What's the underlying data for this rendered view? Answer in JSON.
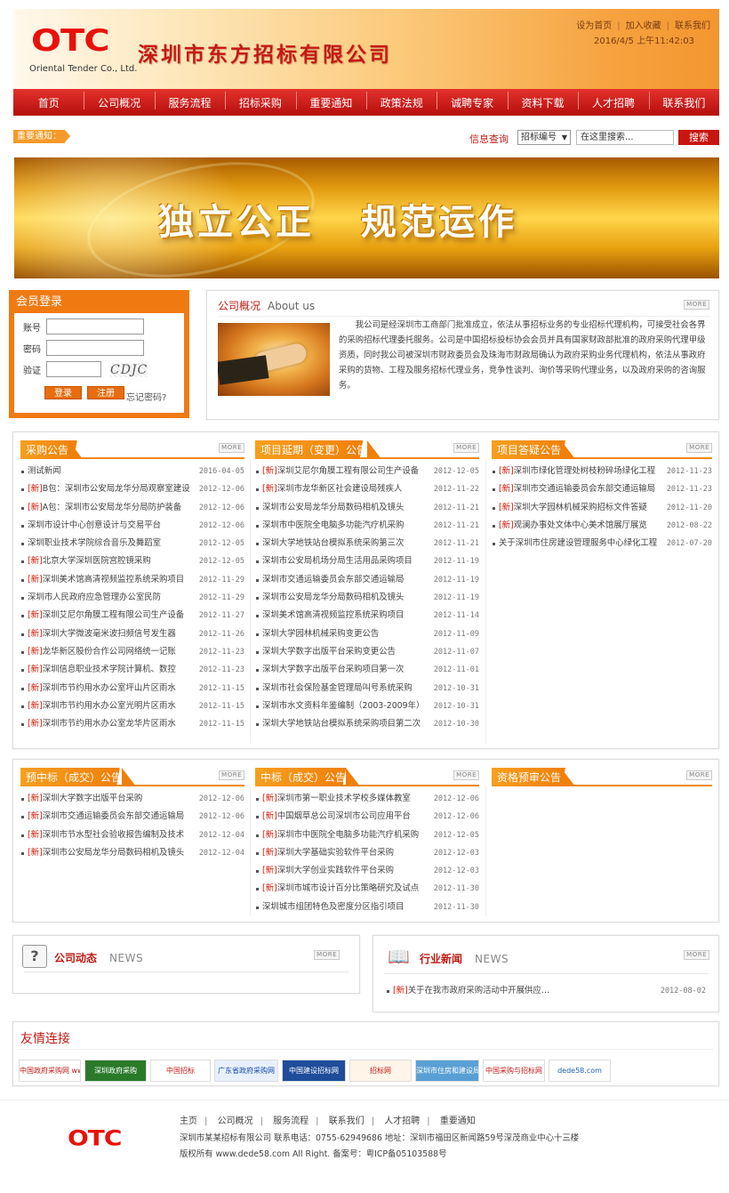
{
  "header": {
    "logo": "OTC",
    "logo_sub": "Oriental Tender Co., Ltd.",
    "company": "深圳市东方招标有限公司",
    "top_links": [
      "设为首页",
      "加入收藏",
      "联系我们"
    ],
    "datetime": "2016/4/5 上午11:42:03"
  },
  "nav": [
    "首页",
    "公司概况",
    "服务流程",
    "招标采购",
    "重要通知",
    "政策法规",
    "诚聘专家",
    "资料下载",
    "人才招聘",
    "联系我们"
  ],
  "notice_label": "重要通知：",
  "search": {
    "label": "信息查询",
    "select": "招标编号",
    "placeholder": "在这里搜索...",
    "button": "搜索"
  },
  "banner": {
    "left": "独立公正",
    "right": "规范运作"
  },
  "login": {
    "title": "会员登录",
    "account": "账号",
    "password": "密码",
    "verify": "验证",
    "captcha": "CDJC",
    "login_btn": "登录",
    "register_btn": "注册",
    "forgot": "忘记密码?"
  },
  "about": {
    "title": "公司概况",
    "title_en": "About us",
    "more": "MORE",
    "text": "我公司是经深圳市工商部门批准成立，依法从事招标业务的专业招标代理机构，可接受社会各界的采购招标代理委托服务。公司是中国招标投标协会会员并具有国家财政部批准的政府采购代理甲级资质，同时我公司被深圳市财政委员会及珠海市财政局确认为政府采购业务代理机构，依法从事政府采购的货物、工程及服务招标代理业务，竞争性谈判、询价等采购代理业务，以及政府采购的咨询服务。"
  },
  "more": "MORE",
  "new_tag": "[新]",
  "procurement": {
    "title": "采购公告",
    "items": [
      {
        "new": false,
        "t": "测试新闻",
        "d": "2016-04-05"
      },
      {
        "new": true,
        "t": "B包：深圳市公安局龙华分局观察室建设",
        "d": "2012-12-06"
      },
      {
        "new": true,
        "t": "A包：深圳市公安局龙华分局防护装备",
        "d": "2012-12-06"
      },
      {
        "new": false,
        "t": "深圳市设计中心创意设计与交易平台",
        "d": "2012-12-06"
      },
      {
        "new": false,
        "t": "深圳职业技术学院综合音乐及舞蹈室",
        "d": "2012-12-05"
      },
      {
        "new": true,
        "t": "北京大学深圳医院宫腔镜采购",
        "d": "2012-12-05"
      },
      {
        "new": true,
        "t": "深圳美术馆高清视频监控系统采购项目",
        "d": "2012-11-29"
      },
      {
        "new": false,
        "t": "深圳市人民政府应急管理办公室民防",
        "d": "2012-11-29"
      },
      {
        "new": true,
        "t": "深圳艾尼尔角膜工程有限公司生产设备",
        "d": "2012-11-27"
      },
      {
        "new": true,
        "t": "深圳大学微波毫米波扫频信号发生器",
        "d": "2012-11-26"
      },
      {
        "new": true,
        "t": "龙华新区股份合作公司网络统一记账",
        "d": "2012-11-23"
      },
      {
        "new": true,
        "t": "深圳信息职业技术学院计算机、数控",
        "d": "2012-11-23"
      },
      {
        "new": true,
        "t": "深圳市节约用水办公室坪山片区雨水",
        "d": "2012-11-15"
      },
      {
        "new": true,
        "t": "深圳市节约用水办公室光明片区雨水",
        "d": "2012-11-15"
      },
      {
        "new": true,
        "t": "深圳市节约用水办公室龙华片区雨水",
        "d": "2012-11-15"
      }
    ]
  },
  "changes": {
    "title": "项目延期（变更）公告",
    "items": [
      {
        "new": true,
        "t": "深圳艾尼尔角膜工程有限公司生产设备",
        "d": "2012-12-05"
      },
      {
        "new": true,
        "t": "深圳市龙华新区社会建设局残疾人",
        "d": "2012-11-22"
      },
      {
        "new": false,
        "t": "深圳市公安局龙华分局数码相机及镜头",
        "d": "2012-11-21"
      },
      {
        "new": false,
        "t": "深圳市中医院全电脑多功能汽疗机采购",
        "d": "2012-11-21"
      },
      {
        "new": false,
        "t": "深圳大学地铁站台模拟系统采购第三次",
        "d": "2012-11-21"
      },
      {
        "new": false,
        "t": "深圳市公安局机场分局生活用品采购项目",
        "d": "2012-11-19"
      },
      {
        "new": false,
        "t": "深圳市交通运输委员会东部交通运输局",
        "d": "2012-11-19"
      },
      {
        "new": false,
        "t": "深圳市公安局龙华分局数码相机及镜头",
        "d": "2012-11-19"
      },
      {
        "new": false,
        "t": "深圳美术馆高清视频监控系统采购项目",
        "d": "2012-11-14"
      },
      {
        "new": false,
        "t": "深圳大学园林机械采购变更公告",
        "d": "2012-11-09"
      },
      {
        "new": false,
        "t": "深圳大学数字出版平台采购变更公告",
        "d": "2012-11-07"
      },
      {
        "new": false,
        "t": "深圳大学数字出版平台采购项目第一次",
        "d": "2012-11-01"
      },
      {
        "new": false,
        "t": "深圳市社会保险基金管理局叫号系统采购",
        "d": "2012-10-31"
      },
      {
        "new": false,
        "t": "深圳市水文资料年鉴编制（2003-2009年）",
        "d": "2012-10-31"
      },
      {
        "new": false,
        "t": "深圳大学地铁站台模拟系统采购项目第二次",
        "d": "2012-10-30"
      }
    ]
  },
  "answers": {
    "title": "项目答疑公告",
    "items": [
      {
        "new": true,
        "t": "深圳市绿化管理处树枝粉碎场绿化工程",
        "d": "2012-11-23"
      },
      {
        "new": true,
        "t": "深圳市交通运输委员会东部交通运输局",
        "d": "2012-11-23"
      },
      {
        "new": true,
        "t": "深圳大学园林机械采购招标文件答疑",
        "d": "2012-11-20"
      },
      {
        "new": true,
        "t": "观澜办事处文体中心美术馆展厅展览",
        "d": "2012-08-22"
      },
      {
        "new": false,
        "t": "关于深圳市住房建设管理服务中心绿化工程",
        "d": "2012-07-20"
      }
    ]
  },
  "pre_award": {
    "title": "预中标（成交）公告",
    "items": [
      {
        "new": true,
        "t": "深圳大学数字出版平台采购",
        "d": "2012-12-06"
      },
      {
        "new": true,
        "t": "深圳市交通运输委员会东部交通运输局",
        "d": "2012-12-06"
      },
      {
        "new": true,
        "t": "深圳市节水型社会验收报告编制及技术",
        "d": "2012-12-04"
      },
      {
        "new": true,
        "t": "深圳市公安局龙华分局数码相机及镜头",
        "d": "2012-12-04"
      }
    ]
  },
  "award": {
    "title": "中标（成交）公告",
    "items": [
      {
        "new": true,
        "t": "深圳市第一职业技术学校多媒体教室",
        "d": "2012-12-06"
      },
      {
        "new": true,
        "t": "中国烟草总公司深圳市公司应用平台",
        "d": "2012-12-06"
      },
      {
        "new": true,
        "t": "深圳市中医院全电脑多功能汽疗机采购",
        "d": "2012-12-05"
      },
      {
        "new": true,
        "t": "深圳大学基础实验软件平台采购",
        "d": "2012-12-03"
      },
      {
        "new": true,
        "t": "深圳大学创业实践软件平台采购",
        "d": "2012-12-03"
      },
      {
        "new": true,
        "t": "深圳市城市设计百分比策略研究及试点",
        "d": "2012-11-30"
      },
      {
        "new": false,
        "t": "深圳城市组团特色及密度分区指引项目",
        "d": "2012-11-30"
      }
    ]
  },
  "prequal": {
    "title": "资格预审公告",
    "items": []
  },
  "company_news": {
    "title": "公司动态",
    "en": "NEWS",
    "items": []
  },
  "industry_news": {
    "title": "行业新闻",
    "en": "NEWS",
    "items": [
      {
        "new": true,
        "t": "关于在我市政府采购活动中开展供应商行贿犯罪档",
        "d": "2012-08-02"
      }
    ]
  },
  "links": {
    "title": "友情连接",
    "logos": [
      {
        "t": "中国政府采购网 www.ccgp.gov.cn",
        "c": "#c01a14",
        "bg": "#fff"
      },
      {
        "t": "深圳政府采购",
        "c": "#fff",
        "bg": "#2a7a2a"
      },
      {
        "t": "中国招标",
        "c": "#c01a14",
        "bg": "#fff"
      },
      {
        "t": "广东省政府采购网",
        "c": "#1a4aa8",
        "bg": "#e8f0ff"
      },
      {
        "t": "中国建设招标网",
        "c": "#fff",
        "bg": "#1f4d9a"
      },
      {
        "t": "招标网",
        "c": "#c01a14",
        "bg": "#fff4e8"
      },
      {
        "t": "深圳市住房和建设局",
        "c": "#fff",
        "bg": "#5a9fd4"
      },
      {
        "t": "中国采购与招标网",
        "c": "#c01a14",
        "bg": "#fff"
      },
      {
        "t": "dede58.com",
        "c": "#1a5fb4",
        "bg": "#fff"
      }
    ]
  },
  "footer": {
    "logo": "OTC",
    "nav": [
      "主页",
      "公司概况",
      "服务流程",
      "联系我们",
      "人才招聘",
      "重要通知"
    ],
    "info": "深圳市某某招标有限公司  联系电话：0755-62949686  地址：深圳市福田区新闻路59号深茂商业中心十三楼",
    "copy": "版权所有 www.dede58.com All Right. 备案号：粤ICP备05103588号"
  }
}
